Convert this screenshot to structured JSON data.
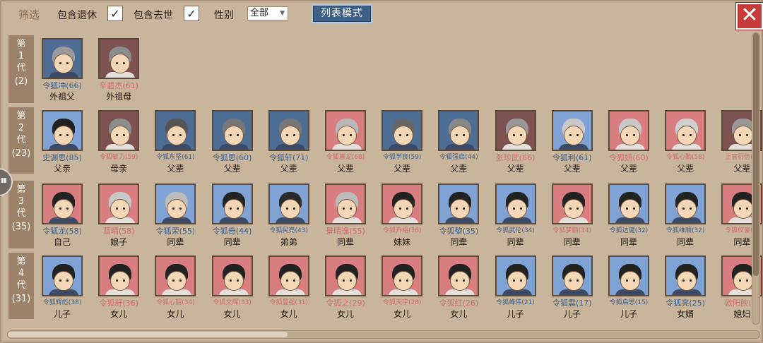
{
  "filter": {
    "title": "筛选",
    "include_retired_label": "包含退休",
    "include_retired_checked": true,
    "include_deceased_label": "包含去世",
    "include_deceased_checked": true,
    "gender_label": "性别",
    "gender_value": "全部",
    "list_mode_label": "列表模式",
    "check_glyph": "✓",
    "close_glyph": "✕"
  },
  "colors": {
    "male_bg": "#4d6d95",
    "male_bg_light": "#7ea3d4",
    "female_bg": "#d87d80",
    "female_bg_dark": "#7c5150"
  },
  "generations": [
    {
      "label": "第\n1\n代",
      "count": "(2)",
      "members": [
        {
          "name": "令狐冲(66)",
          "relation": "外祖父",
          "gender": "male",
          "bg": "dark_male",
          "hair": "#9a9a9a"
        },
        {
          "name": "辛碧杰(61)",
          "relation": "外祖母",
          "gender": "female",
          "bg": "dark_female",
          "hair": "#8c8c8c"
        }
      ]
    },
    {
      "label": "第\n2\n代",
      "count": "(23)",
      "members": [
        {
          "name": "史渊思(85)",
          "relation": "父亲",
          "gender": "male",
          "bg": "light_male",
          "hair": "#222"
        },
        {
          "name": "令狐敏力(59)",
          "relation": "母亲",
          "gender": "female",
          "bg": "dark_female",
          "hair": "#8c8c8c",
          "small": true
        },
        {
          "name": "令狐东坚(61)",
          "relation": "父辈",
          "gender": "male",
          "bg": "dark_male",
          "hair": "#555",
          "small": true
        },
        {
          "name": "令狐思(60)",
          "relation": "父辈",
          "gender": "male",
          "bg": "dark_male",
          "hair": "#777"
        },
        {
          "name": "令狐轩(71)",
          "relation": "父辈",
          "gender": "male",
          "bg": "dark_male",
          "hair": "#777"
        },
        {
          "name": "令狐蕙龙(68)",
          "relation": "父辈",
          "gender": "female",
          "bg": "light_female",
          "hair": "#b8b8b8",
          "small": true
        },
        {
          "name": "令狐学良(59)",
          "relation": "父辈",
          "gender": "male",
          "bg": "dark_male",
          "hair": "#666",
          "small": true
        },
        {
          "name": "令狐强启(44)",
          "relation": "父辈",
          "gender": "male",
          "bg": "dark_male",
          "hair": "#888",
          "small": true
        },
        {
          "name": "张珍武(66)",
          "relation": "父辈",
          "gender": "female",
          "bg": "dark_female",
          "hair": "#999"
        },
        {
          "name": "令狐利(61)",
          "relation": "父辈",
          "gender": "male",
          "bg": "light_male",
          "hair": "#c8c8c8"
        },
        {
          "name": "令狐妍(60)",
          "relation": "父辈",
          "gender": "female",
          "bg": "light_female",
          "hair": "#c8c8c8"
        },
        {
          "name": "令狐心勤(58)",
          "relation": "父辈",
          "gender": "female",
          "bg": "light_female",
          "hair": "#d0d0d0",
          "small": true
        },
        {
          "name": "上官衍信(…",
          "relation": "父辈",
          "gender": "female",
          "bg": "dark_female",
          "hair": "#999",
          "small": true
        }
      ]
    },
    {
      "label": "第\n3\n代",
      "count": "(35)",
      "members": [
        {
          "name": "令狐龙(58)",
          "relation": "自己",
          "gender": "male",
          "bg": "light_female",
          "hair": "#222"
        },
        {
          "name": "蓝晴(58)",
          "relation": "娘子",
          "gender": "female",
          "bg": "light_female",
          "hair": "#c8c8c8"
        },
        {
          "name": "令狐荣(55)",
          "relation": "同辈",
          "gender": "male",
          "bg": "light_male",
          "hair": "#bbb"
        },
        {
          "name": "令狐奇(44)",
          "relation": "同辈",
          "gender": "male",
          "bg": "light_male",
          "hair": "#222"
        },
        {
          "name": "令狐民亮(43)",
          "relation": "弟弟",
          "gender": "male",
          "bg": "light_male",
          "hair": "#2a2a2a",
          "small": true
        },
        {
          "name": "景晴逸(55)",
          "relation": "同辈",
          "gender": "female",
          "bg": "light_female",
          "hair": "#bbb"
        },
        {
          "name": "令狐卉绍(36)",
          "relation": "妹妹",
          "gender": "female",
          "bg": "light_female",
          "hair": "#222",
          "small": true
        },
        {
          "name": "令狐黎(35)",
          "relation": "同辈",
          "gender": "male",
          "bg": "light_male",
          "hair": "#222"
        },
        {
          "name": "令狐武伦(34)",
          "relation": "同辈",
          "gender": "male",
          "bg": "light_male",
          "hair": "#222",
          "small": true
        },
        {
          "name": "令狐梦鹏(34)",
          "relation": "同辈",
          "gender": "female",
          "bg": "light_female",
          "hair": "#222",
          "small": true
        },
        {
          "name": "令狐达健(32)",
          "relation": "同辈",
          "gender": "male",
          "bg": "light_male",
          "hair": "#222",
          "small": true
        },
        {
          "name": "令狐维顺(32)",
          "relation": "同辈",
          "gender": "male",
          "bg": "light_male",
          "hair": "#222",
          "small": true
        },
        {
          "name": "令狐仪豪(…",
          "relation": "同辈",
          "gender": "female",
          "bg": "light_female",
          "hair": "#222",
          "small": true
        }
      ]
    },
    {
      "label": "第\n4\n代",
      "count": "(31)",
      "members": [
        {
          "name": "令狐辉彪(38)",
          "relation": "儿子",
          "gender": "male",
          "bg": "light_male",
          "hair": "#222",
          "small": true
        },
        {
          "name": "令狐舒(36)",
          "relation": "女儿",
          "gender": "female",
          "bg": "light_female",
          "hair": "#222"
        },
        {
          "name": "令狐心韶(34)",
          "relation": "女儿",
          "gender": "female",
          "bg": "light_female",
          "hair": "#222",
          "small": true
        },
        {
          "name": "令狐文辉(33)",
          "relation": "女儿",
          "gender": "female",
          "bg": "light_female",
          "hair": "#222",
          "small": true
        },
        {
          "name": "令狐曼强(31)",
          "relation": "女儿",
          "gender": "female",
          "bg": "light_female",
          "hair": "#222",
          "small": true
        },
        {
          "name": "令狐之(29)",
          "relation": "女儿",
          "gender": "female",
          "bg": "light_female",
          "hair": "#222"
        },
        {
          "name": "令狐天宇(28)",
          "relation": "女儿",
          "gender": "female",
          "bg": "light_female",
          "hair": "#222",
          "small": true
        },
        {
          "name": "令狐红(26)",
          "relation": "女儿",
          "gender": "female",
          "bg": "light_female",
          "hair": "#222"
        },
        {
          "name": "令狐峰伟(21)",
          "relation": "儿子",
          "gender": "male",
          "bg": "light_male",
          "hair": "#222",
          "small": true
        },
        {
          "name": "令狐震(17)",
          "relation": "儿子",
          "gender": "male",
          "bg": "light_male",
          "hair": "#222"
        },
        {
          "name": "令狐启思(15)",
          "relation": "儿子",
          "gender": "male",
          "bg": "light_male",
          "hair": "#222",
          "small": true
        },
        {
          "name": "令狐亮(25)",
          "relation": "女婿",
          "gender": "male",
          "bg": "light_male",
          "hair": "#222"
        },
        {
          "name": "欧阳腴(…",
          "relation": "媳妇",
          "gender": "female",
          "bg": "light_female",
          "hair": "#222"
        }
      ]
    }
  ]
}
